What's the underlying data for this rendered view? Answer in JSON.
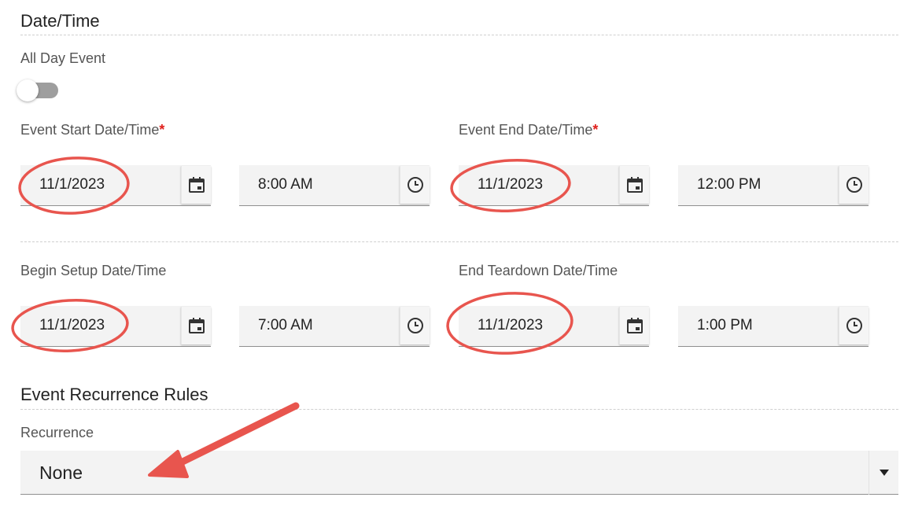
{
  "datetime_section": {
    "title": "Date/Time",
    "all_day": {
      "label": "All Day Event",
      "checked": false
    },
    "start": {
      "label": "Event Start Date/Time",
      "required_mark": "*",
      "date": "11/1/2023",
      "time": "8:00 AM"
    },
    "end": {
      "label": "Event End Date/Time",
      "required_mark": "*",
      "date": "11/1/2023",
      "time": "12:00 PM"
    },
    "setup": {
      "label": "Begin Setup Date/Time",
      "date": "11/1/2023",
      "time": "7:00 AM"
    },
    "teardown": {
      "label": "End Teardown Date/Time",
      "date": "11/1/2023",
      "time": "1:00 PM"
    }
  },
  "recurrence_section": {
    "title": "Event Recurrence Rules",
    "label": "Recurrence",
    "selected": "None"
  },
  "icons": {
    "date_button": "calendar-icon",
    "time_button": "clock-icon",
    "select_caret": "caret-down-icon"
  },
  "colors": {
    "required": "#e0201c",
    "annotation": "#e8554e",
    "field_bg": "#f3f3f3",
    "toggle_track": "#9e9e9e"
  }
}
